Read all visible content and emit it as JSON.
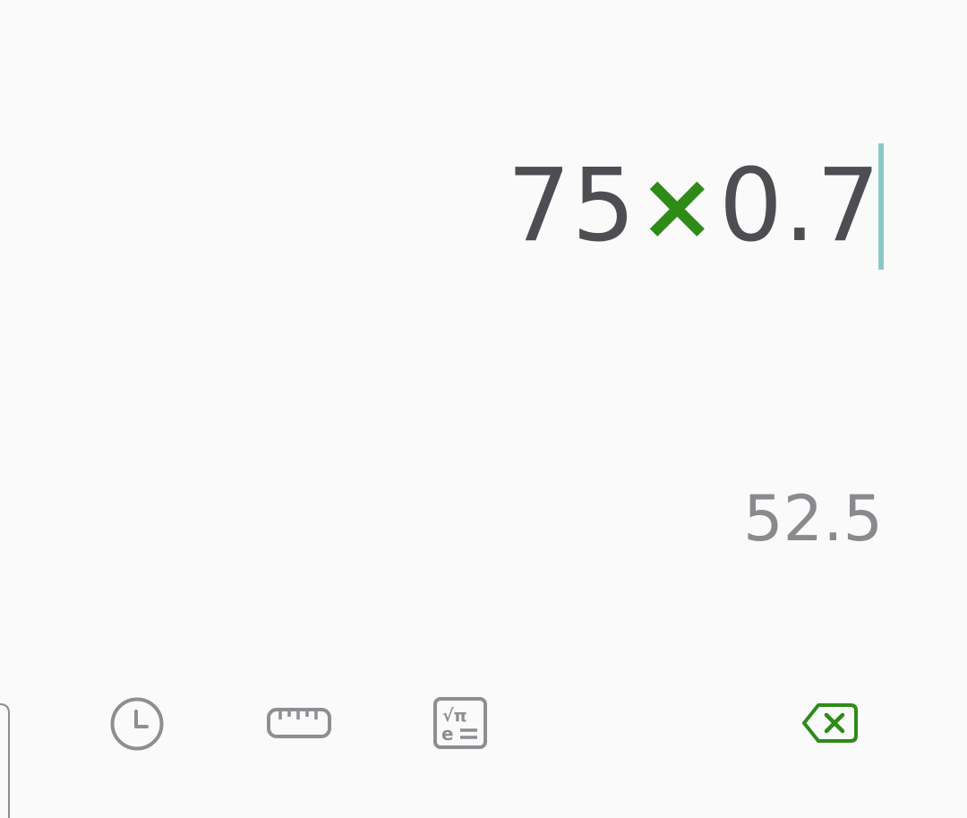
{
  "display": {
    "operand_1": "75",
    "operator": "×",
    "operand_2": "0.7",
    "result_preview": "52.5"
  },
  "toolbar": {
    "history_icon": "clock-icon",
    "unit_converter_icon": "ruler-icon",
    "scientific_icon": "sqrt-pi-e-icon",
    "backspace_icon": "backspace-icon"
  },
  "colors": {
    "background": "#fafafa",
    "expression_text": "#4e4e52",
    "operator": "#2e8b17",
    "cursor": "#8cc9c6",
    "result_text": "#8a8a8e",
    "icon_gray": "#8e8e92",
    "backspace_green": "#2e8b17"
  }
}
